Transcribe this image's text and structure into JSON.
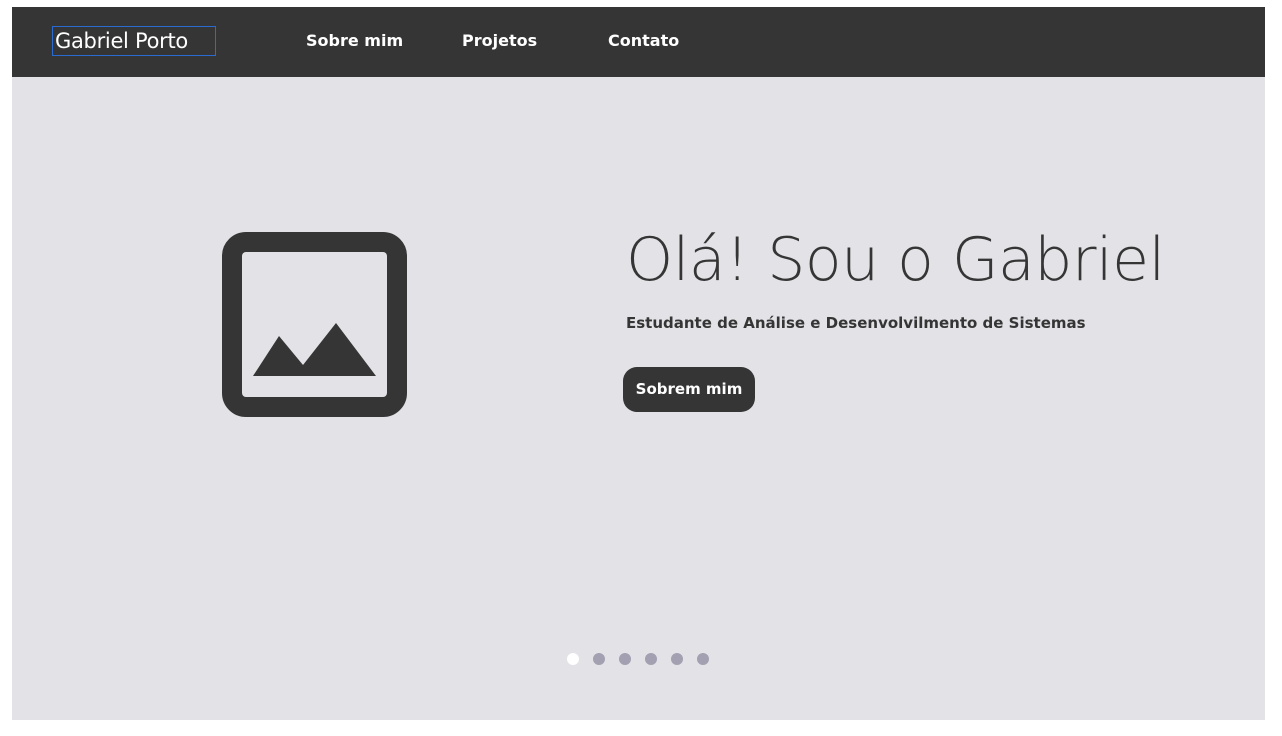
{
  "header": {
    "brand": "Gabriel Porto",
    "nav": [
      {
        "label": "Sobre mim"
      },
      {
        "label": "Projetos"
      },
      {
        "label": "Contato"
      }
    ]
  },
  "hero": {
    "image_icon": "image-placeholder-icon",
    "title": "Olá! Sou o Gabriel",
    "subtitle": "Estudante de Análise e Desenvolvilmento de Sistemas",
    "button_label": "Sobrem mim"
  },
  "carousel": {
    "slide_count": 6,
    "active_index": 0
  },
  "colors": {
    "navbar": "#353535",
    "hero_background": "#e3e2e7",
    "text_dark": "#353535",
    "dot_active": "#ffffff",
    "dot_inactive": "#a2a0b1",
    "brand_focus_outline": "#2a6bd1"
  }
}
